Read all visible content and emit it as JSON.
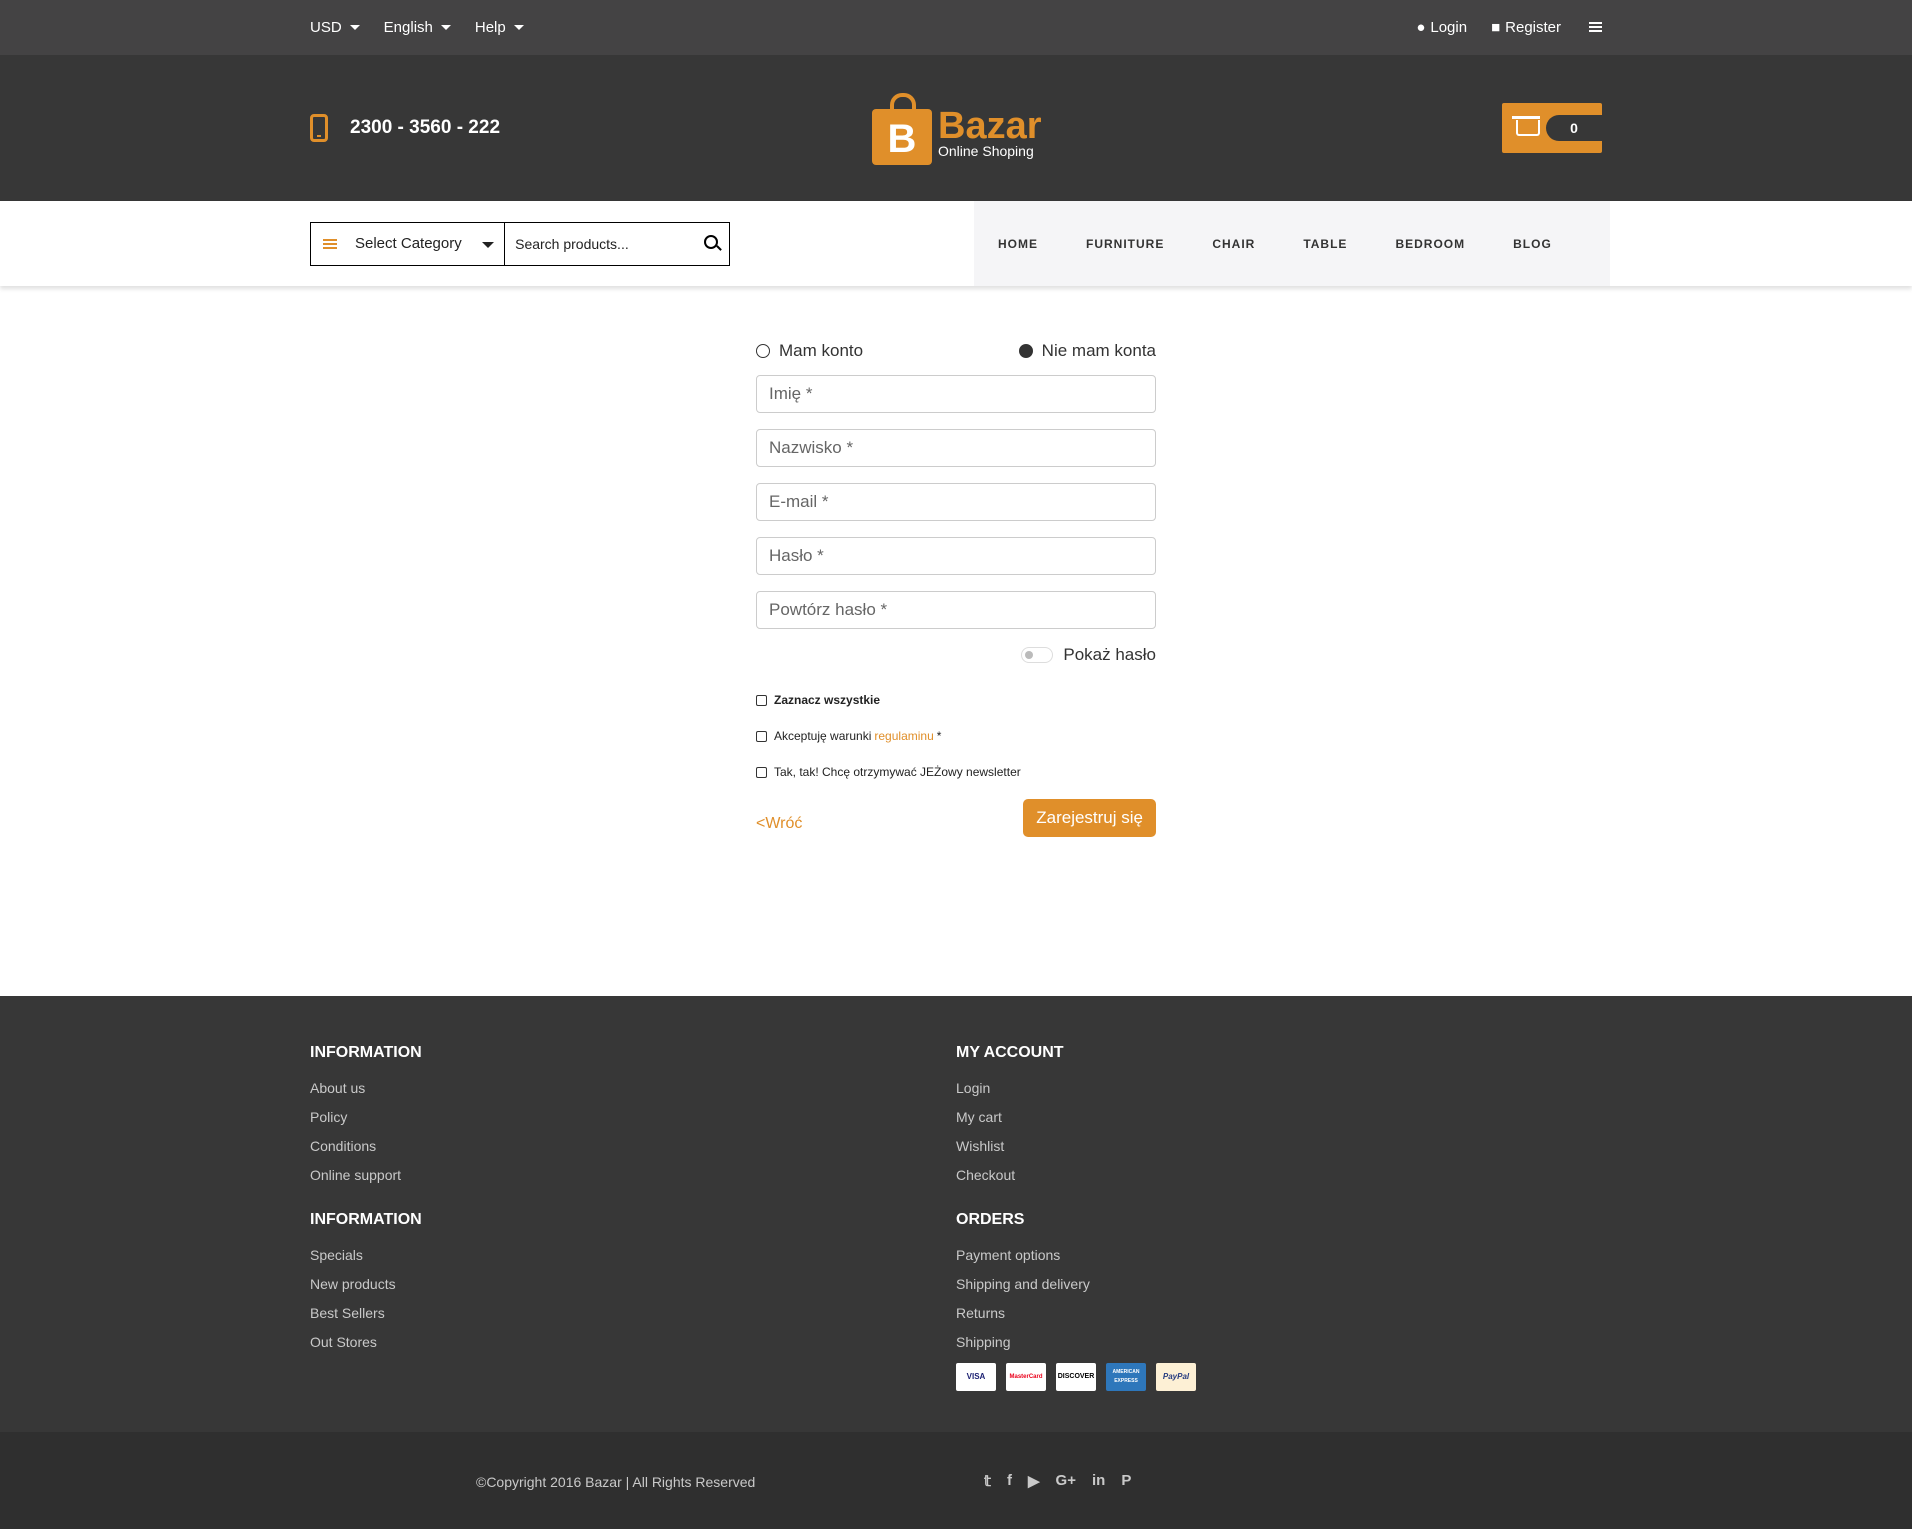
{
  "topbar": {
    "currency": "USD",
    "language": "English",
    "help": "Help",
    "login": "Login",
    "register": "Register",
    "icons": {
      "login": "user-icon",
      "register": "lock-icon",
      "menu": "hamburger-icon"
    }
  },
  "header": {
    "phone": "2300 - 3560 - 222",
    "logo_letter": "B",
    "logo_name": "Bazar",
    "logo_sub": "Online Shoping",
    "cart_count": "0"
  },
  "search": {
    "category": "Select Category",
    "placeholder": "Search products..."
  },
  "nav": {
    "items": [
      "HOME",
      "FURNITURE",
      "CHAIR",
      "TABLE",
      "BEDROOM",
      "BLOG"
    ]
  },
  "form": {
    "radio_have": "Mam konto",
    "radio_new": "Nie mam konta",
    "first_name": "Imię *",
    "last_name": "Nazwisko *",
    "email": "E-mail *",
    "password": "Hasło *",
    "password_repeat": "Powtórz hasło *",
    "show_password": "Pokaż hasło",
    "select_all": "Zaznacz wszystkie",
    "terms_prefix": "Akceptuję warunki",
    "terms_link": "regulaminu",
    "terms_suffix": "*",
    "newsletter": "Tak, tak! Chcę otrzymywać JEŻowy newsletter",
    "back": "<Wróć",
    "submit": "Zarejestruj się"
  },
  "footer": {
    "col1": [
      {
        "title": "INFORMATION",
        "links": [
          "About us",
          "Policy",
          "Conditions",
          "Online support"
        ]
      },
      {
        "title": "INFORMATION",
        "links": [
          "Specials",
          "New products",
          "Best Sellers",
          "Out Stores"
        ]
      }
    ],
    "col2": [
      {
        "title": "MY ACCOUNT",
        "links": [
          "Login",
          "My cart",
          "Wishlist",
          "Checkout"
        ]
      },
      {
        "title": "ORDERS",
        "links": [
          "Payment options",
          "Shipping and delivery",
          "Returns",
          "Shipping"
        ]
      }
    ],
    "cards": [
      "VISA",
      "MasterCard",
      "DISCOVER",
      "AMERICAN EXPRESS",
      "PayPal"
    ],
    "copyright": "©Copyright 2016 Bazar | All Rights Reserved",
    "social": [
      "twitter-icon",
      "facebook-icon",
      "youtube-icon",
      "google-plus-icon",
      "linkedin-icon",
      "pinterest-icon"
    ]
  },
  "colors": {
    "accent": "#e08f2a",
    "dark": "#373737",
    "topbar": "#444344"
  }
}
